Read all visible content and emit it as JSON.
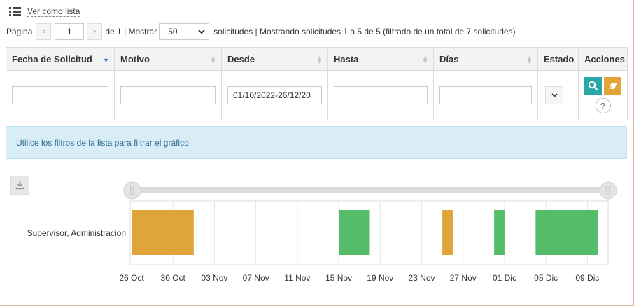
{
  "view_toggle": {
    "label": "Ver como lista",
    "icon": "list-icon"
  },
  "pager": {
    "page_label": "Página",
    "prev_icon": "chevron-left-icon",
    "page_value": "1",
    "next_icon": "chevron-right-icon",
    "of_text": "de 1 | Mostrar",
    "page_size": "50",
    "summary": "solicitudes | Mostrando solicitudes 1 a 5 de 5 (filtrado de un total de 7 solicitudes)"
  },
  "table": {
    "columns": [
      {
        "label": "Fecha de Solicitud",
        "sorted": "desc"
      },
      {
        "label": "Motivo"
      },
      {
        "label": "Desde"
      },
      {
        "label": "Hasta"
      },
      {
        "label": "Días"
      },
      {
        "label": "Estado"
      },
      {
        "label": "Acciones"
      }
    ],
    "filters": {
      "fecha": "",
      "motivo": "",
      "desde": "01/10/2022-26/12/20",
      "hasta": "",
      "dias": ""
    },
    "actions": {
      "search_icon": "search-icon",
      "clear_icon": "eraser-icon",
      "help_label": "?"
    }
  },
  "banner": {
    "text": "Utilice los filtros de la lista para filtrar el gráfico."
  },
  "chart": {
    "download_icon": "download-icon",
    "slider_handle_icon": "drag-handle-icon",
    "row_label": "Supervisor, Administracion",
    "tick_labels": [
      "26 Oct",
      "30 Oct",
      "03 Nov",
      "07 Nov",
      "11 Nov",
      "15 Nov",
      "19 Nov",
      "23 Nov",
      "27 Nov",
      "01 Dic",
      "05 Dic",
      "09 Dic"
    ],
    "colors": {
      "pending": "#e0a53a",
      "approved": "#55bd6a"
    }
  },
  "chart_data": {
    "type": "bar",
    "orientation": "timeline",
    "categories": [
      "Supervisor, Administracion"
    ],
    "x_axis_range": [
      "2022-10-26",
      "2022-12-11"
    ],
    "grid": true,
    "bars": [
      {
        "start": "2022-10-26",
        "end": "2022-11-01",
        "color": "#e0a53a"
      },
      {
        "start": "2022-11-15",
        "end": "2022-11-18",
        "color": "#55bd6a"
      },
      {
        "start": "2022-11-25",
        "end": "2022-11-26",
        "color": "#e0a53a"
      },
      {
        "start": "2022-11-30",
        "end": "2022-12-01",
        "color": "#55bd6a"
      },
      {
        "start": "2022-12-04",
        "end": "2022-12-10",
        "color": "#55bd6a"
      }
    ]
  }
}
